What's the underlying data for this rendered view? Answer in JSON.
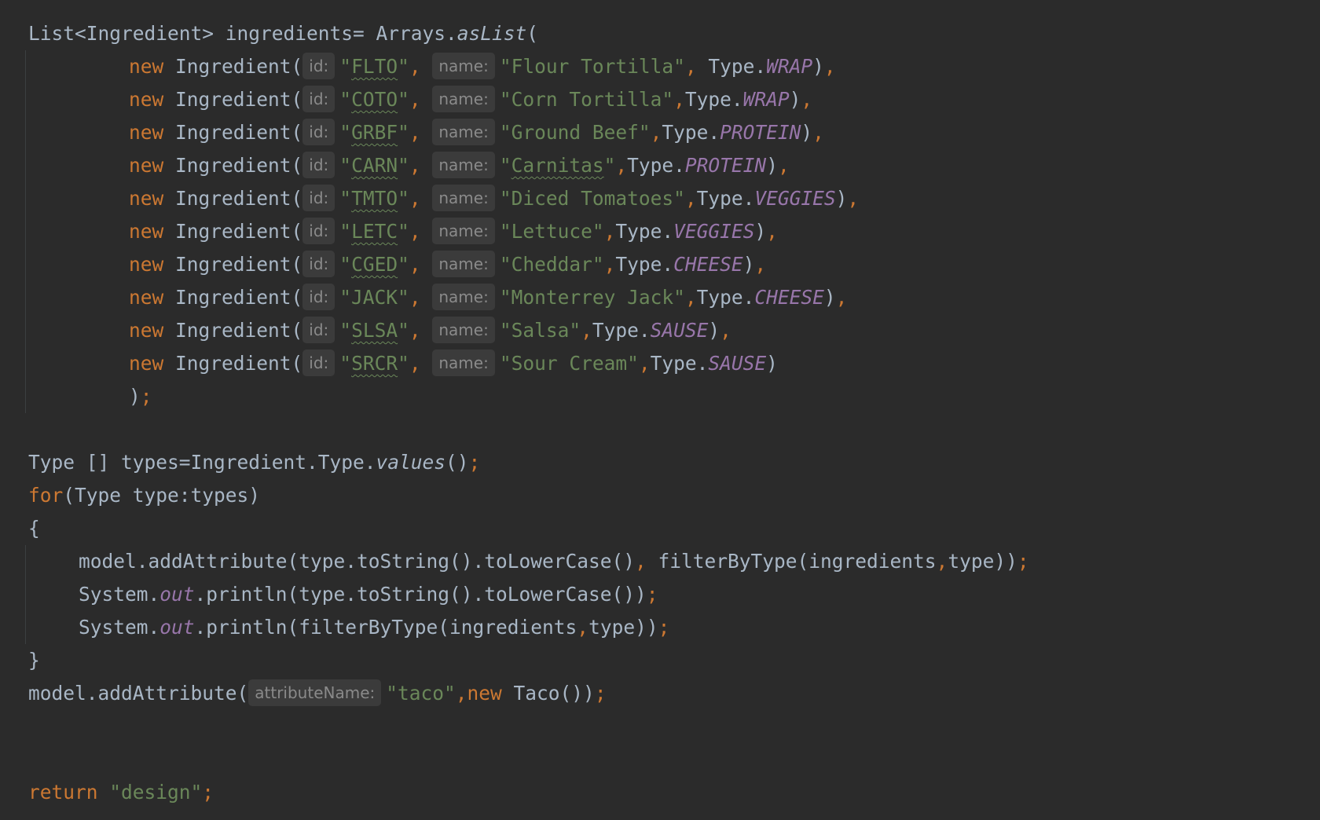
{
  "colors": {
    "background": "#2b2b2b",
    "default_text": "#a9b7c6",
    "keyword": "#cc7832",
    "string": "#6a8759",
    "constant": "#9876aa",
    "hint_bg": "#3b3b3b",
    "hint_text": "#8a8a8a"
  },
  "code": {
    "decl": {
      "a": "List<Ingredient> ingredients= Arrays.",
      "method": "asList",
      "b": "("
    },
    "hints": {
      "id": "id:",
      "name": "name:",
      "attr": "attributeName:"
    },
    "kw_new": "new",
    "cls": "Ingredient(",
    "type_prefix": "Type.",
    "ingredients": [
      {
        "id": "\"FLTO\"",
        "name": "\"Flour Tortilla\"",
        "type": "WRAP",
        "sep_after_name": ", ",
        "tail": ")",
        "end": ","
      },
      {
        "id": "\"COTO\"",
        "name": "\"Corn Tortilla\"",
        "type": "WRAP",
        "sep_after_name": ",",
        "tail": ")",
        "end": ","
      },
      {
        "id": "\"GRBF\"",
        "name": "\"Ground Beef\"",
        "type": "PROTEIN",
        "sep_after_name": ",",
        "tail": ")",
        "end": ","
      },
      {
        "id": "\"CARN\"",
        "name": "\"Carnitas\"",
        "type": "PROTEIN",
        "sep_after_name": ",",
        "tail": ")",
        "end": ","
      },
      {
        "id": "\"TMTO\"",
        "name": "\"Diced Tomatoes\"",
        "type": "VEGGIES",
        "sep_after_name": ",",
        "tail": ")",
        "end": ","
      },
      {
        "id": "\"LETC\"",
        "name": "\"Lettuce\"",
        "type": "VEGGIES",
        "sep_after_name": ",",
        "tail": ")",
        "end": ","
      },
      {
        "id": "\"CGED\"",
        "name": "\"Cheddar\"",
        "type": "CHEESE",
        "sep_after_name": ",",
        "tail": ")",
        "end": ","
      },
      {
        "id": "\"JACK\"",
        "name": "\"Monterrey Jack\"",
        "type": "CHEESE",
        "sep_after_name": ",",
        "tail": ")",
        "end": ","
      },
      {
        "id": "\"SLSA\"",
        "name": "\"Salsa\"",
        "type": "SAUSE",
        "sep_after_name": ",",
        "tail": ")",
        "end": ","
      },
      {
        "id": "\"SRCR\"",
        "name": "\"Sour Cream\"",
        "type": "SAUSE",
        "sep_after_name": ",",
        "tail": ")",
        "end": ""
      }
    ],
    "close_list": {
      "paren": ")",
      "semi": ";"
    },
    "types_line": {
      "a": "Type [] types=Ingredient.Type.",
      "method": "values",
      "b": "()",
      "semi": ";"
    },
    "for_line": {
      "kw": "for",
      "rest": "(Type type:types)"
    },
    "open_brace": "{",
    "body1": {
      "a": "model.addAttribute(type.toString().toLowerCase()",
      "comma1": ",",
      "b": " filterByType(ingredients",
      "comma2": ",",
      "c": "type))",
      "semi": ";"
    },
    "body2": {
      "a": "System.",
      "field": "out",
      "b": ".println(type.toString().toLowerCase())",
      "semi": ";"
    },
    "body3": {
      "a": "System.",
      "field": "out",
      "b": ".println(filterByType(ingredients",
      "comma": ",",
      "c": "type))",
      "semi": ";"
    },
    "close_brace": "}",
    "taco_line": {
      "a": "model.addAttribute(",
      "str": "\"taco\"",
      "comma": ",",
      "kw": "new",
      "b": " Taco())",
      "semi": ";"
    },
    "return_line": {
      "kw": "return",
      "str": "\"design\"",
      "semi": ";"
    }
  }
}
